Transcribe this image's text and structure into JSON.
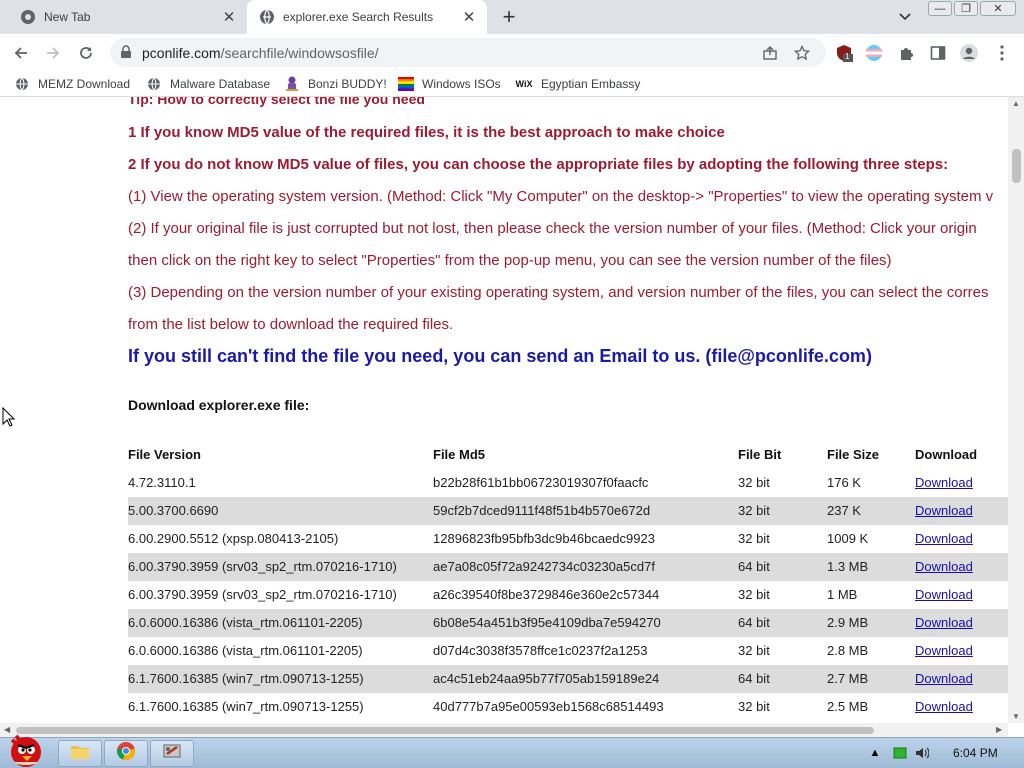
{
  "browser": {
    "tabs": [
      {
        "title": "New Tab",
        "active": false
      },
      {
        "title": "explorer.exe Search Results",
        "active": true
      }
    ],
    "url_host": "pconlife.com",
    "url_path": "/searchfile/windowsosfile/",
    "extension_badge": "1"
  },
  "bookmarks": [
    {
      "label": "MEMZ Download",
      "icon": "globe-icon"
    },
    {
      "label": "Malware Database",
      "icon": "globe-icon"
    },
    {
      "label": "Bonzi BUDDY!",
      "icon": "bonzi-icon"
    },
    {
      "label": "Windows ISOs",
      "icon": "flag-icon"
    },
    {
      "label": "Egyptian Embassy",
      "icon": "wix-icon"
    }
  ],
  "content": {
    "tip_heading": "Tip: How to correctly select the file you need",
    "step1": "1 If you know MD5 value of the required files, it is the best approach to make choice",
    "step2": "2 If you do not know MD5 value of files, you can choose the appropriate files by adopting the following three steps:",
    "sub1": " (1) View the operating system version. (Method: Click \"My Computer\" on the desktop-> \"Properties\" to view the operating system v",
    "sub2a": " (2) If your original file is just corrupted but not lost, then please check the version number of your files. (Method: Click your origin",
    "sub2b": "then click on the right key to select \"Properties\" from the pop-up menu, you can see the version number of the files)",
    "sub3a": " (3) Depending on the version number of your existing operating system, and version number of the files, you can select the corres",
    "sub3b": "from the list below to download the required files.",
    "email_line": "If you still can't find the file you need, you can send an Email to us. (file@pconlife.com)",
    "download_heading": "Download explorer.exe file:"
  },
  "table": {
    "headers": [
      "File Version",
      "File Md5",
      "File Bit",
      "File Size",
      "Download"
    ],
    "rows": [
      [
        "4.72.3110.1",
        "b22b28f61b1bb06723019307f0faacfc",
        "32 bit",
        "176 K",
        "Download"
      ],
      [
        "5.00.3700.6690",
        "59cf2b7dced9111f48f51b4b570e672d",
        "32 bit",
        "237 K",
        "Download"
      ],
      [
        "6.00.2900.5512 (xpsp.080413-2105)",
        "12896823fb95bfb3dc9b46bcaedc9923",
        "32 bit",
        "1009 K",
        "Download"
      ],
      [
        "6.00.3790.3959 (srv03_sp2_rtm.070216-1710)",
        "ae7a08c05f72a9242734c03230a5cd7f",
        "64 bit",
        "1.3 MB",
        "Download"
      ],
      [
        "6.00.3790.3959 (srv03_sp2_rtm.070216-1710)",
        "a26c39540f8be3729846e360e2c57344",
        "32 bit",
        "1 MB",
        "Download"
      ],
      [
        "6.0.6000.16386 (vista_rtm.061101-2205)",
        "6b08e54a451b3f95e4109dba7e594270",
        "64 bit",
        "2.9 MB",
        "Download"
      ],
      [
        "6.0.6000.16386 (vista_rtm.061101-2205)",
        "d07d4c3038f3578ffce1c0237f2a1253",
        "32 bit",
        "2.8 MB",
        "Download"
      ],
      [
        "6.1.7600.16385 (win7_rtm.090713-1255)",
        "ac4c51eb24aa95b77f705ab159189e24",
        "64 bit",
        "2.7 MB",
        "Download"
      ],
      [
        "6.1.7600.16385 (win7_rtm.090713-1255)",
        "40d777b7a95e00593eb1568c68514493",
        "32 bit",
        "2.5 MB",
        "Download"
      ]
    ]
  },
  "taskbar": {
    "clock": "6:04 PM"
  },
  "colors": {
    "instruction_red": "#9c1b35",
    "email_blue": "#1a1aa6",
    "row_alt": "#dcdcdc",
    "link": "#1a0dab"
  }
}
